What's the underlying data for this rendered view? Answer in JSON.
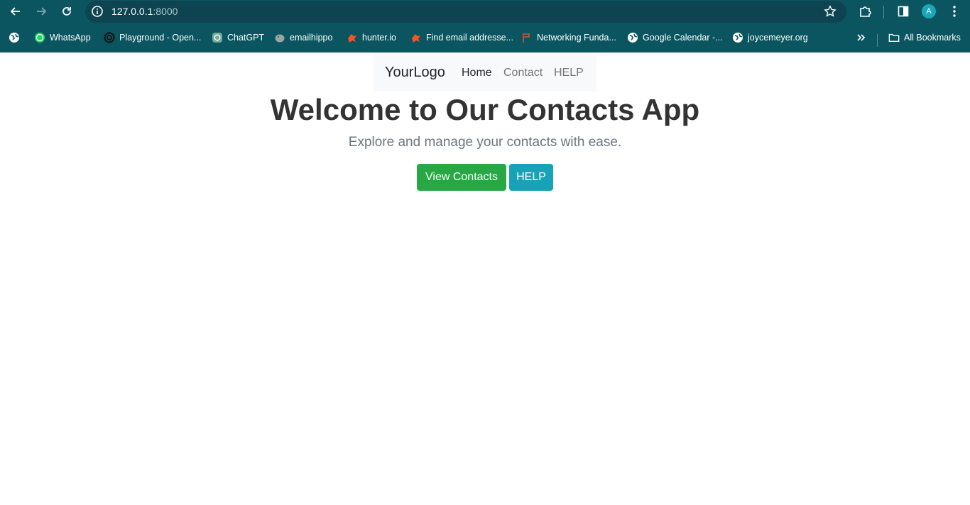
{
  "browser": {
    "url_host": "127.0.0.1",
    "url_port": ":8000",
    "profile_initial": "A",
    "bookmarks": [
      {
        "label": "WhatsApp",
        "icon": "whatsapp-icon"
      },
      {
        "label": "Playground - Open...",
        "icon": "openai-icon"
      },
      {
        "label": "ChatGPT",
        "icon": "chatgpt-icon"
      },
      {
        "label": "emailhippo",
        "icon": "hippo-icon"
      },
      {
        "label": "hunter.io",
        "icon": "hunter-icon"
      },
      {
        "label": "Find email addresse...",
        "icon": "hunter-icon"
      },
      {
        "label": "Networking Funda...",
        "icon": "flag-icon"
      },
      {
        "label": "Google Calendar -...",
        "icon": "globe-icon"
      },
      {
        "label": "joycemeyer.org",
        "icon": "globe-icon"
      }
    ],
    "all_bookmarks_label": "All Bookmarks"
  },
  "navbar": {
    "brand": "YourLogo",
    "links": [
      "Home",
      "Contact",
      "HELP"
    ]
  },
  "hero": {
    "title": "Welcome to Our Contacts App",
    "subtitle": "Explore and manage your contacts with ease.",
    "primary_button": "View Contacts",
    "secondary_button": "HELP"
  },
  "colors": {
    "chrome_bg": "#0b5561",
    "success": "#28a745",
    "info": "#17a2b8",
    "navbar_bg": "#f8f9fa"
  }
}
